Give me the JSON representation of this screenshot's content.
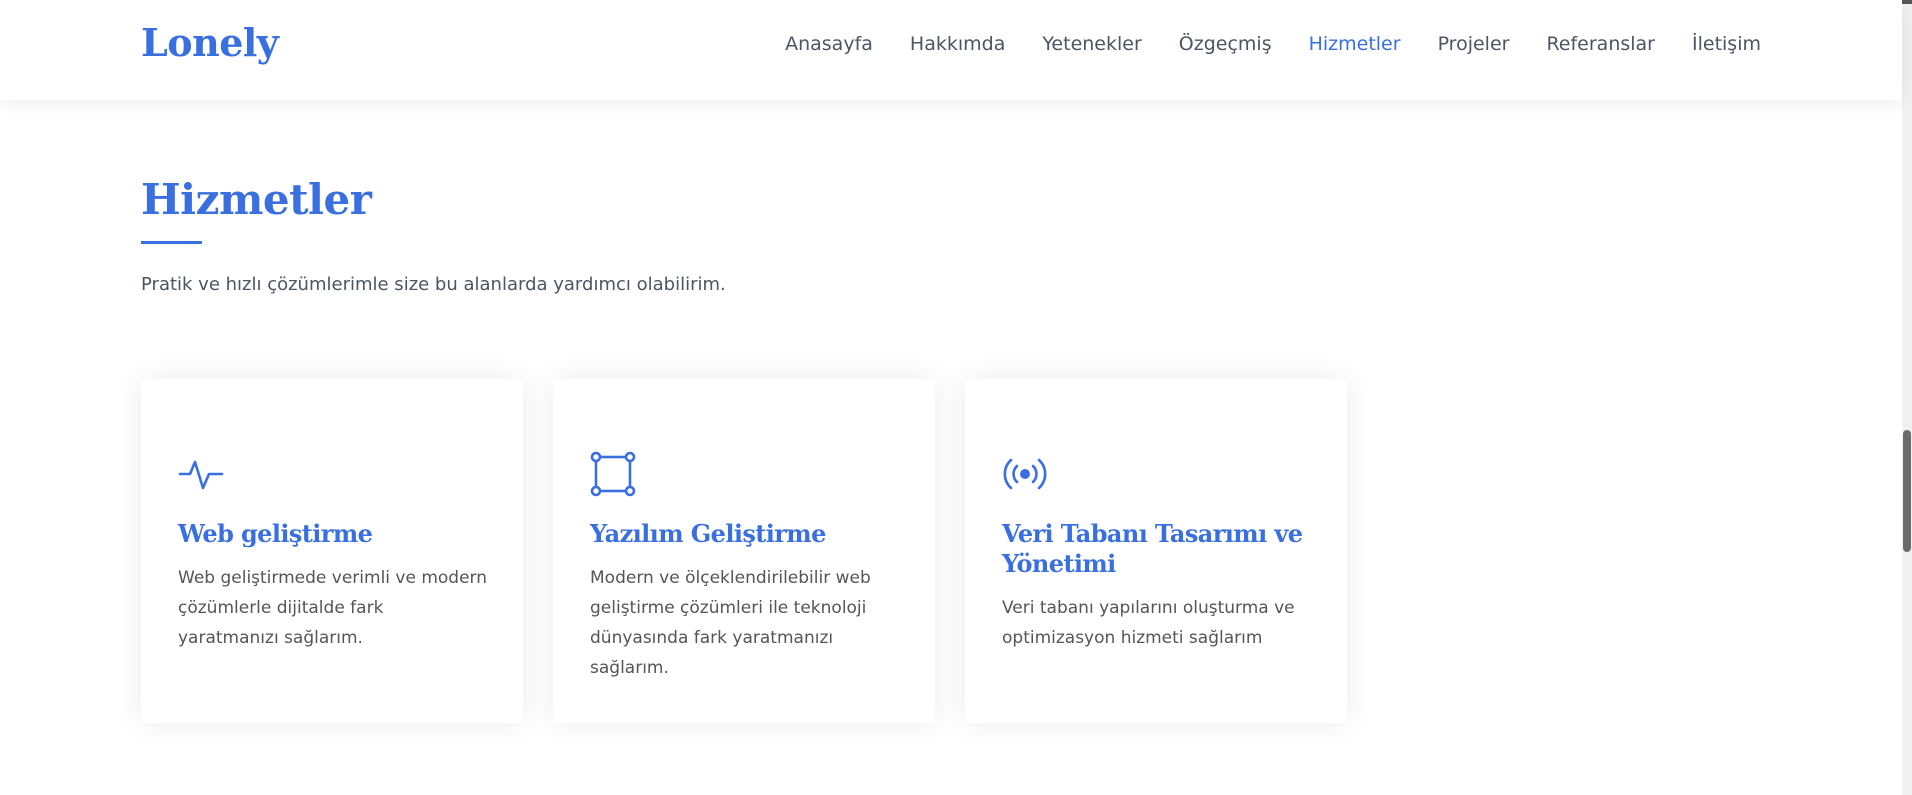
{
  "header": {
    "logo": "Lonely",
    "nav": [
      {
        "label": "Anasayfa",
        "active": false
      },
      {
        "label": "Hakkımda",
        "active": false
      },
      {
        "label": "Yetenekler",
        "active": false
      },
      {
        "label": "Özgeçmiş",
        "active": false
      },
      {
        "label": "Hizmetler",
        "active": true
      },
      {
        "label": "Projeler",
        "active": false
      },
      {
        "label": "Referanslar",
        "active": false
      },
      {
        "label": "İletişim",
        "active": false
      }
    ]
  },
  "section": {
    "title": "Hizmetler",
    "subtitle": "Pratik ve hızlı çözümlerimle size bu alanlarda yardımcı olabilirim."
  },
  "services": [
    {
      "icon": "activity-icon",
      "title": "Web geliştirme",
      "description": "Web geliştirmede verimli ve modern çözümlerle dijitalde fark yaratmanızı sağlarım."
    },
    {
      "icon": "bounding-box-icon",
      "title": "Yazılım Geliştirme",
      "description": "Modern ve ölçeklendirilebilir web geliştirme çözümleri ile teknoloji dünyasında fark yaratmanızı sağlarım."
    },
    {
      "icon": "broadcast-icon",
      "title": "Veri Tabanı Tasarımı ve Yönetimi",
      "description": "Veri tabanı yapılarını oluşturma ve optimizasyon hizmeti sağlarım"
    }
  ],
  "colors": {
    "accent": "#3a6fe0",
    "text": "#4b5563"
  }
}
